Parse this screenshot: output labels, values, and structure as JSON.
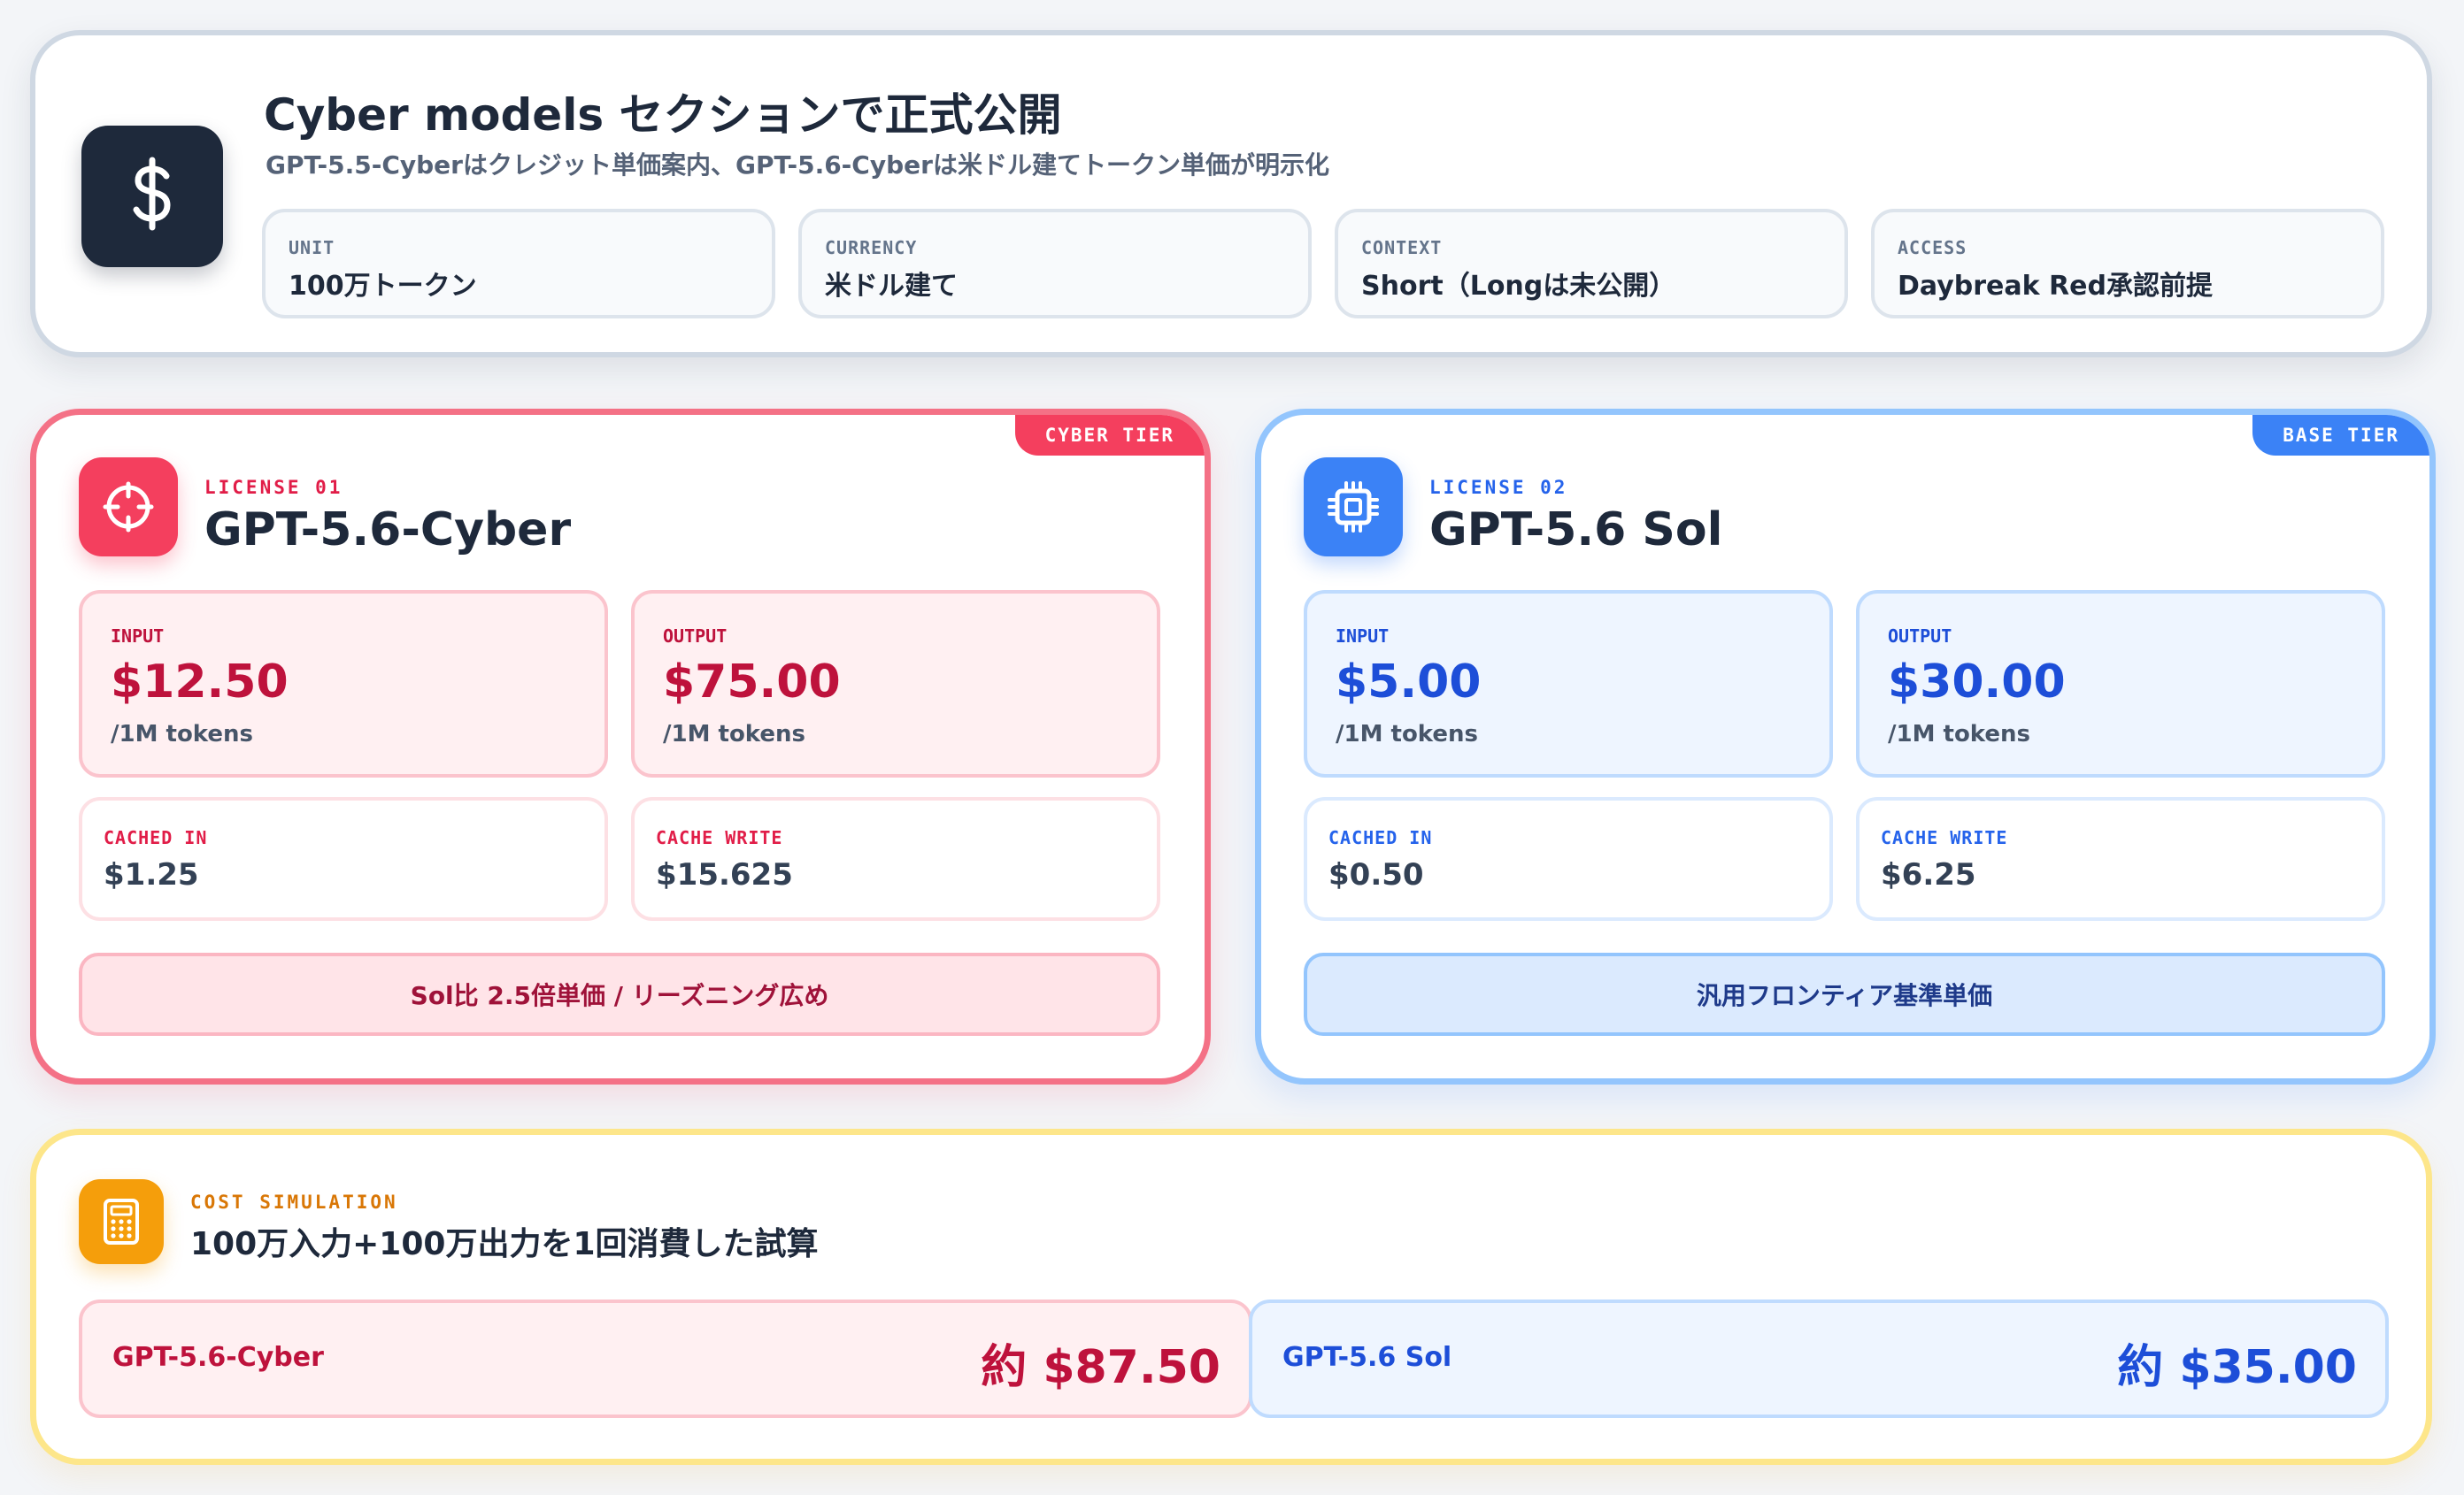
{
  "header": {
    "icon": "dollar-icon",
    "title": "Cyber models セクションで正式公開",
    "subtitle": "GPT-5.5-Cyberはクレジット単価案内、GPT-5.6-Cyberは米ドル建てトークン単価が明示化",
    "meta": [
      {
        "label": "UNIT",
        "value": "100万トークン"
      },
      {
        "label": "CURRENCY",
        "value": "米ドル建て"
      },
      {
        "label": "CONTEXT",
        "value": "Short（Longは未公開）"
      },
      {
        "label": "ACCESS",
        "value": "Daybreak Red承認前提"
      }
    ]
  },
  "licenses": {
    "cyber": {
      "tier": "CYBER TIER",
      "icon": "crosshair-icon",
      "number": "LICENSE 01",
      "name": "GPT-5.6-Cyber",
      "input_label": "INPUT",
      "input_price": "$12.50",
      "input_unit": "/1M tokens",
      "output_label": "OUTPUT",
      "output_price": "$75.00",
      "output_unit": "/1M tokens",
      "cached_label": "CACHED IN",
      "cached_value": "$1.25",
      "write_label": "CACHE WRITE",
      "write_value": "$15.625",
      "note": "Sol比 2.5倍単価 / リーズニング広め"
    },
    "sol": {
      "tier": "BASE TIER",
      "icon": "chip-icon",
      "number": "LICENSE 02",
      "name": "GPT-5.6 Sol",
      "input_label": "INPUT",
      "input_price": "$5.00",
      "input_unit": "/1M tokens",
      "output_label": "OUTPUT",
      "output_price": "$30.00",
      "output_unit": "/1M tokens",
      "cached_label": "CACHED IN",
      "cached_value": "$0.50",
      "write_label": "CACHE WRITE",
      "write_value": "$6.25",
      "note": "汎用フロンティア基準単価"
    }
  },
  "simulation": {
    "icon": "calculator-icon",
    "eyebrow": "COST SIMULATION",
    "title": "100万入力+100万出力を1回消費した試算",
    "cyber": {
      "name": "GPT-5.6-Cyber",
      "cost": "約 $87.50"
    },
    "sol": {
      "name": "GPT-5.6 Sol",
      "cost": "約 $35.00"
    }
  },
  "colors": {
    "dark": "#1e293b",
    "cyber_accent": "#f43f5e",
    "sol_accent": "#3b82f6",
    "sim_accent": "#f59e0b"
  }
}
